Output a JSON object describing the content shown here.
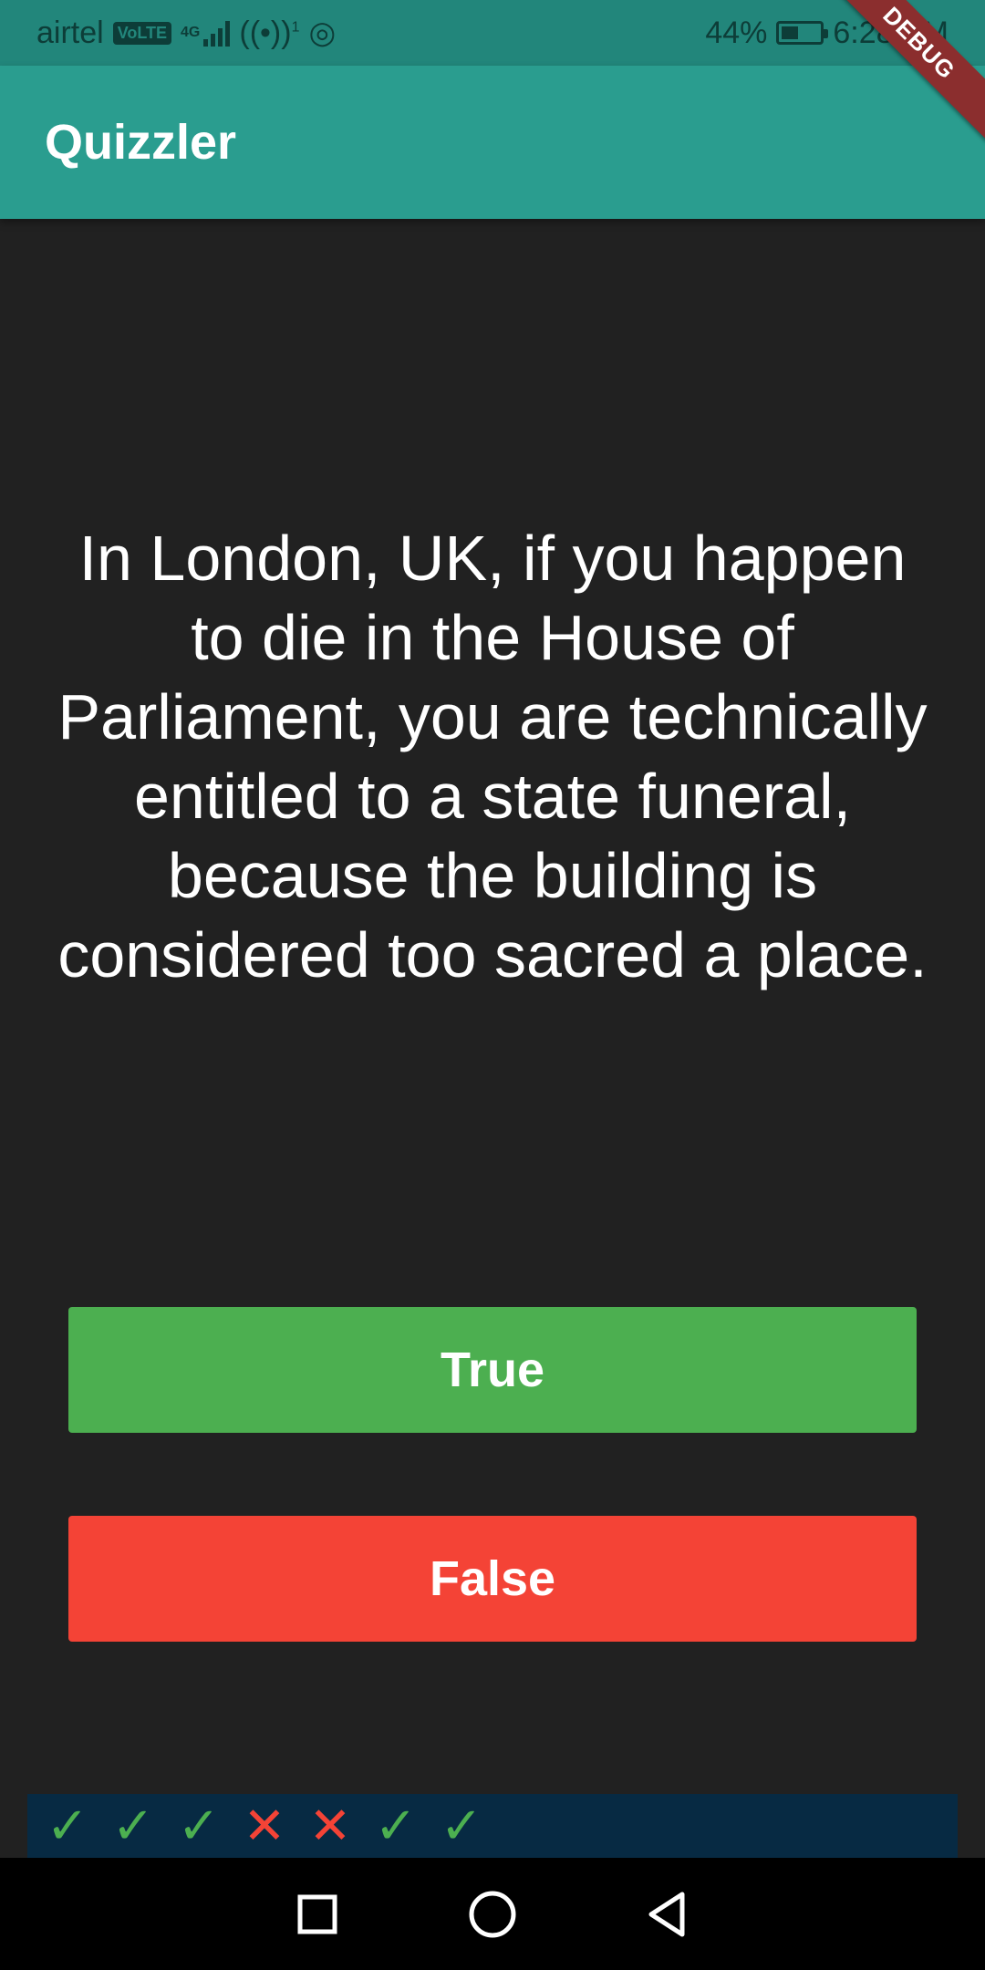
{
  "status_bar": {
    "carrier": "airtel",
    "volte": "VoLTE",
    "network": "4G",
    "hotspot_superscript": "1",
    "battery_percent": "44%",
    "battery_level": 0.44,
    "time": "6:28 PM"
  },
  "app_bar": {
    "title": "Quizzler",
    "color": "#2a9d8f"
  },
  "debug_banner": "DEBUG",
  "question": {
    "text": "In London, UK, if you happen to die in the House of Parliament, you are technically entitled to a state funeral, because the building is considered too sacred a place."
  },
  "buttons": {
    "true_label": "True",
    "true_color": "#4caf50",
    "false_label": "False",
    "false_color": "#f44336"
  },
  "score_keeper": [
    {
      "result": "correct",
      "icon": "check-icon",
      "color": "#4caf50"
    },
    {
      "result": "correct",
      "icon": "check-icon",
      "color": "#4caf50"
    },
    {
      "result": "correct",
      "icon": "check-icon",
      "color": "#4caf50"
    },
    {
      "result": "wrong",
      "icon": "close-icon",
      "color": "#f44336"
    },
    {
      "result": "wrong",
      "icon": "close-icon",
      "color": "#f44336"
    },
    {
      "result": "correct",
      "icon": "check-icon",
      "color": "#4caf50"
    },
    {
      "result": "correct",
      "icon": "check-icon",
      "color": "#4caf50"
    }
  ],
  "nav_bar": {
    "buttons": [
      "recents-icon",
      "home-icon",
      "back-icon"
    ]
  }
}
